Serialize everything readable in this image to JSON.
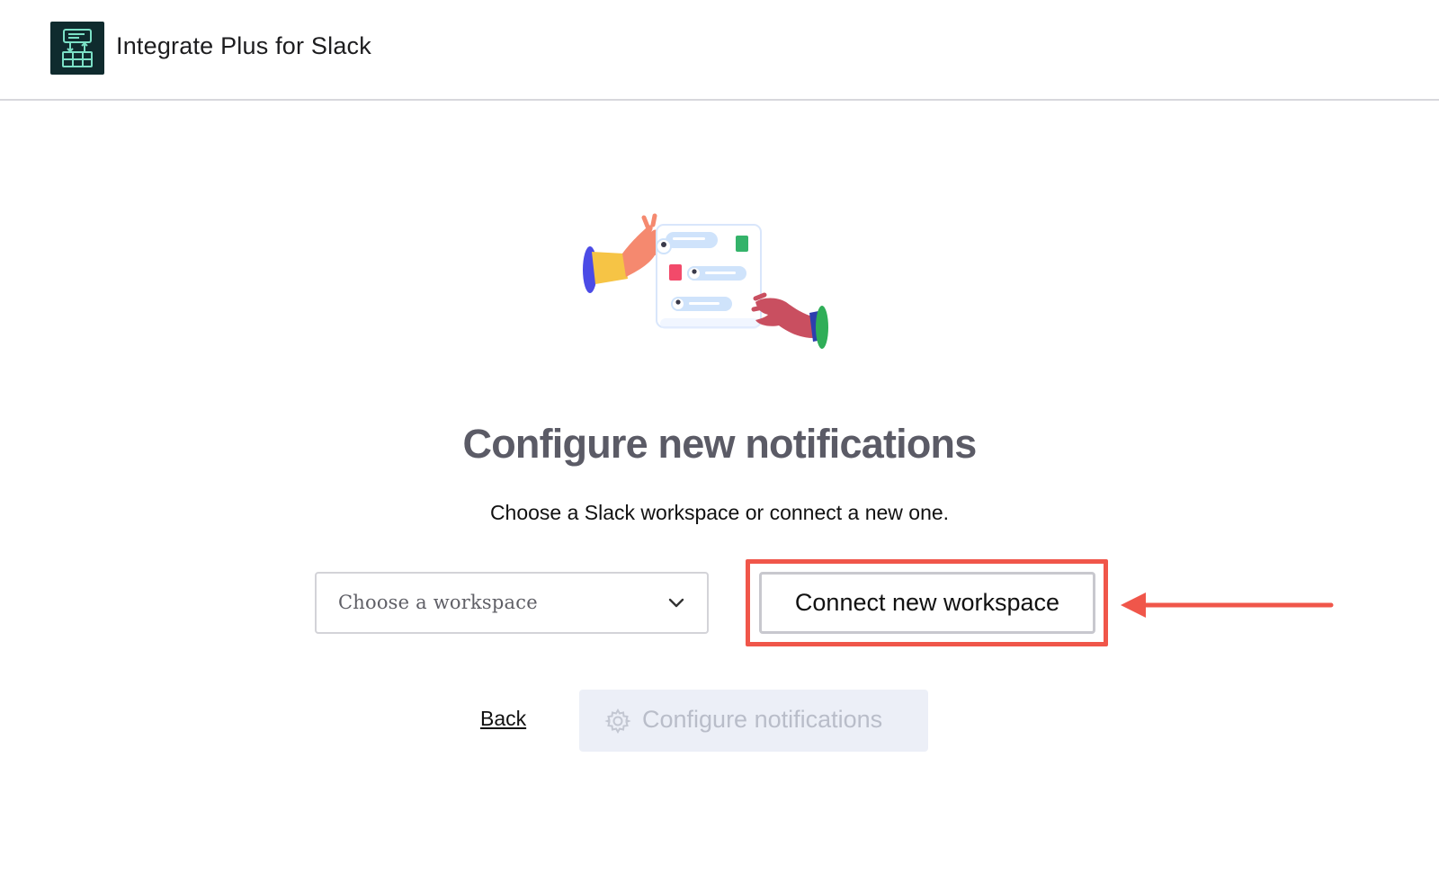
{
  "header": {
    "app_title": "Integrate Plus for Slack",
    "logo_icon": "sheet-sync-icon"
  },
  "hero": {
    "illustration": "hands-exchanging-chat-window-illustration"
  },
  "main": {
    "title": "Configure new notifications",
    "subtitle": "Choose a Slack workspace or connect a new one.",
    "workspace_select": {
      "placeholder": "Choose a workspace",
      "icon": "chevron-down-icon"
    },
    "connect_button_label": "Connect new workspace",
    "back_label": "Back",
    "configure_button": {
      "label": "Configure notifications",
      "icon": "gear-icon",
      "disabled": true
    }
  },
  "annotation": {
    "highlight_color": "#f0564a",
    "arrow_icon": "left-arrow-icon"
  },
  "colors": {
    "title": "#5b5b66",
    "logo_bg": "#0f2b2e",
    "logo_accent": "#7be0c6",
    "disabled_bg": "#eceff7",
    "disabled_text": "#b9bdc9"
  }
}
